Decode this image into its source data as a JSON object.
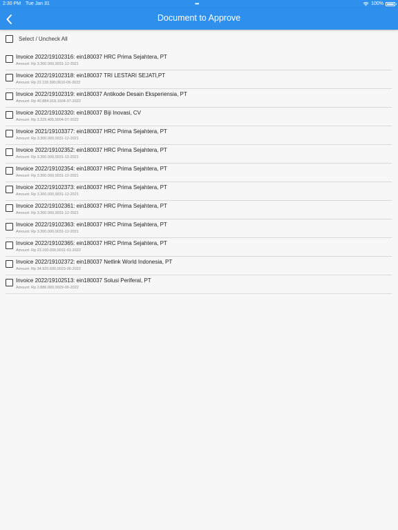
{
  "status_bar": {
    "time": "2:30 PM",
    "date": "Tue Jan 31",
    "multitask": "•••",
    "battery": "100%"
  },
  "header": {
    "title": "Document to Approve"
  },
  "select_all": {
    "label": "Select / Uncheck All"
  },
  "items": [
    {
      "title": "Invoice 2022/19102316: ein180037 HRC Prima Sejahtera, PT",
      "amount": "Amount: Rp 3.300.000,00",
      "date": "31-12-2021"
    },
    {
      "title": "Invoice 2022/19102318: ein180037 TRI LESTARI SEJATI,PT",
      "amount": "Amount: Rp 22.118.390,06",
      "date": "10-06-2022"
    },
    {
      "title": "Invoice 2022/19102319: ein180037 Antikode Desain Eksperiensia, PT",
      "amount": "Amount: Rp 40.884.918,16",
      "date": "04-07-2022"
    },
    {
      "title": "Invoice 2022/19102320: ein180037 Biji Inovasi, CV",
      "amount": "Amount: Rp 3.329.405,00",
      "date": "04-07-2022"
    },
    {
      "title": "Invoice 2021/19103377: ein180037 HRC Prima Sejahtera, PT",
      "amount": "Amount: Rp 3.300.000,00",
      "date": "31-12-2021"
    },
    {
      "title": "Invoice 2022/19102352: ein180037 HRC Prima Sejahtera, PT",
      "amount": "Amount: Rp 3.300.000,00",
      "date": "31-12-2021"
    },
    {
      "title": "Invoice 2022/19102354: ein180037 HRC Prima Sejahtera, PT",
      "amount": "Amount: Rp 3.300.000,00",
      "date": "31-12-2021"
    },
    {
      "title": "Invoice 2022/19102373: ein180037 HRC Prima Sejahtera, PT",
      "amount": "Amount: Rp 3.300.000,00",
      "date": "31-12-2021"
    },
    {
      "title": "Invoice 2022/19102361: ein180037 HRC Prima Sejahtera, PT",
      "amount": "Amount: Rp 3.300.000,00",
      "date": "31-12-2021"
    },
    {
      "title": "Invoice 2022/19102363: ein180037 HRC Prima Sejahtera, PT",
      "amount": "Amount: Rp 3.300.000,00",
      "date": "31-12-2021"
    },
    {
      "title": "Invoice 2022/19102365: ein180037 HRC Prima Sejahtera, PT",
      "amount": "Amount: Rp 23.100.000,00",
      "date": "31-01-2022"
    },
    {
      "title": "Invoice 2022/19102372: ein180037 Netlink World Indonesia, PT",
      "amount": "Amount: Rp 34.920.600,00",
      "date": "23-06-2022"
    },
    {
      "title": "Invoice 2022/19102513: ein180037 Solusi Periferal, PT",
      "amount": "Amount: Rp 2.886.000,00",
      "date": "29-06-2022"
    }
  ],
  "colors": {
    "accent": "#2f8fec",
    "background": "#f7f7f7",
    "divider": "#d8d8d8"
  },
  "icons": {
    "back": "chevron-left-icon",
    "wifi": "wifi-icon",
    "battery": "battery-icon",
    "checkbox": "checkbox-icon"
  }
}
